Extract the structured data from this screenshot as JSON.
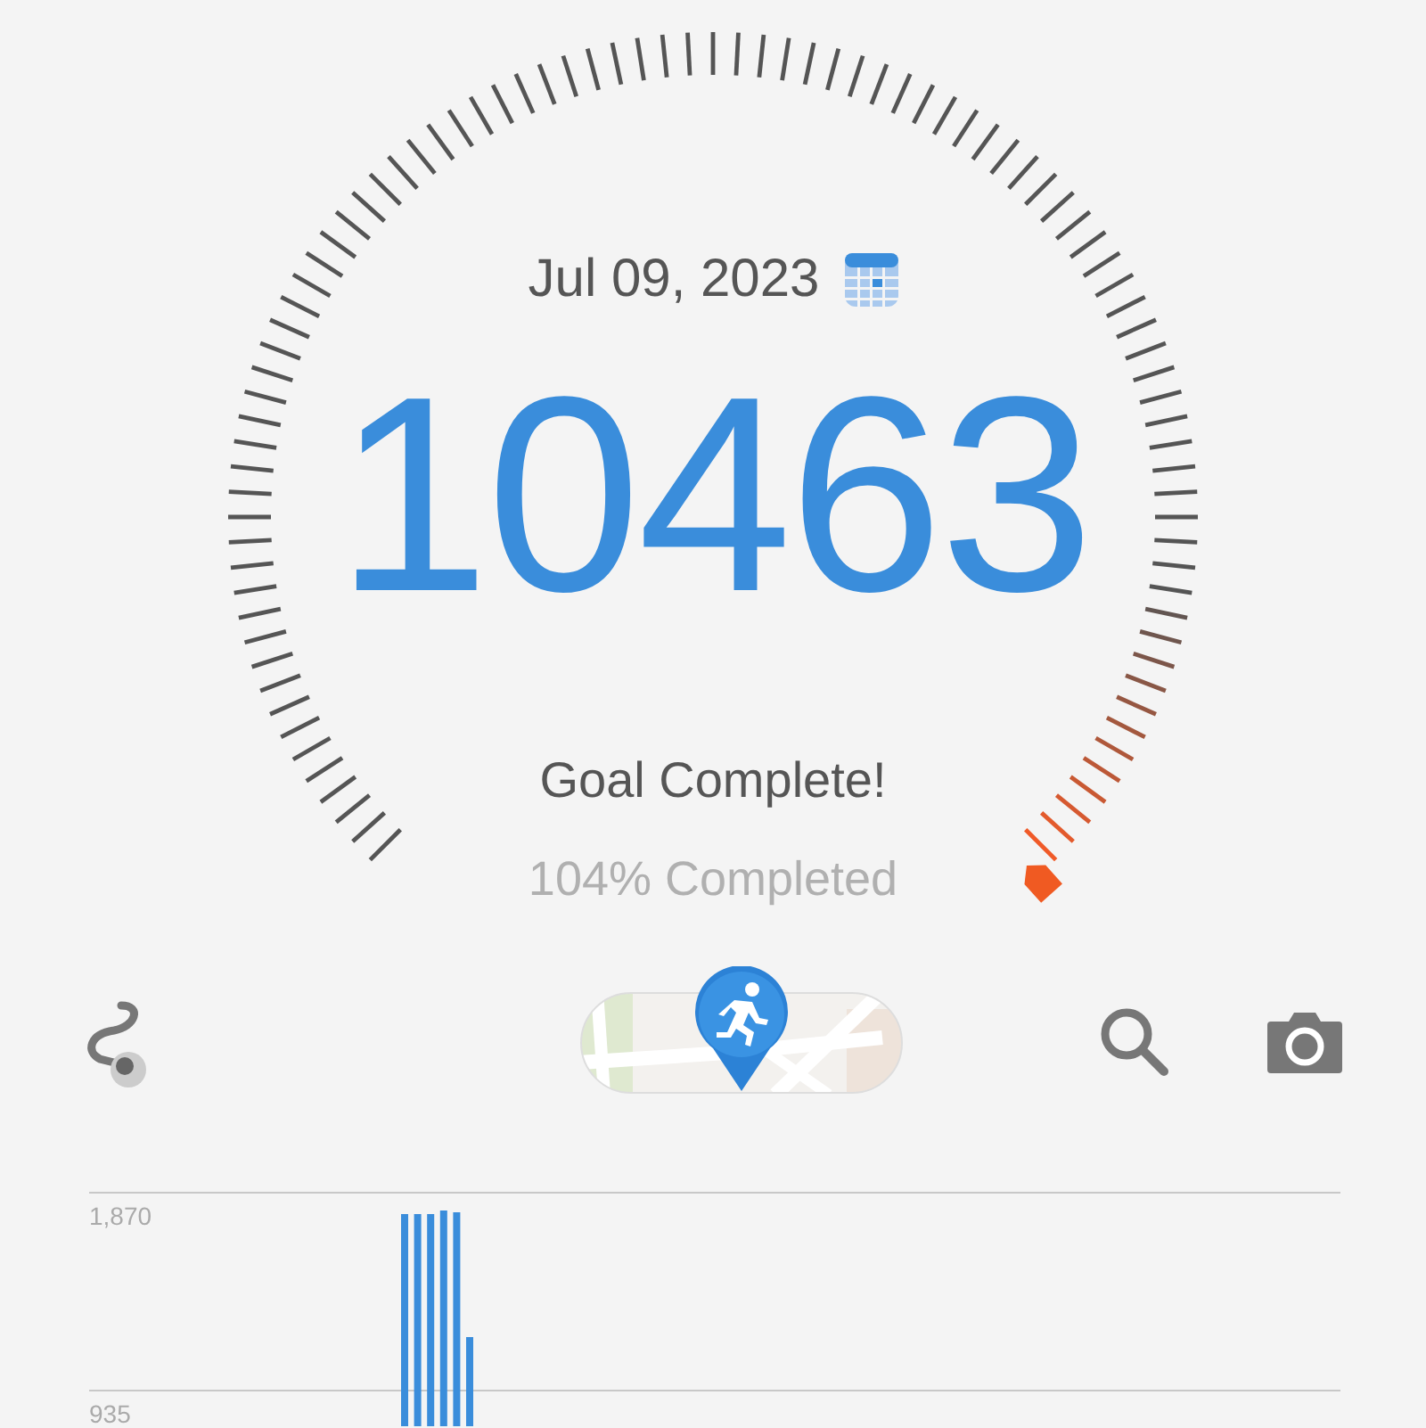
{
  "gauge": {
    "date": "Jul 09, 2023",
    "steps": "10463",
    "status": "Goal Complete!",
    "percent": "104% Completed"
  },
  "chart": {
    "axis_labels": [
      "1,870",
      "935"
    ]
  }
}
